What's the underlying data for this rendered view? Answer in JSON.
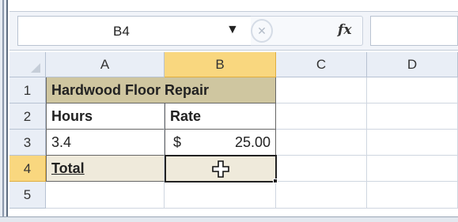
{
  "formula_bar": {
    "name_box": "B4",
    "name_box_arrow": "▼",
    "cancel_symbol": "✕",
    "fx_label": "fx",
    "formula_value": ""
  },
  "columns": [
    "A",
    "B",
    "C",
    "D"
  ],
  "rows": [
    "1",
    "2",
    "3",
    "4",
    "5"
  ],
  "cells": {
    "a1": "Hardwood Floor Repair",
    "a2": "Hours",
    "b2": "Rate",
    "a3": "3.4",
    "b3_currency": "$",
    "b3_value": "25.00",
    "a4": "Total"
  },
  "selection": {
    "active_cell": "B4"
  },
  "colors": {
    "header_selected": "#f9d77f",
    "title_fill": "#cfc6a0",
    "total_fill": "#efeadb"
  },
  "icons": {
    "cursor": "plus-cursor-icon",
    "cancel": "cancel-icon",
    "fx": "insert-function-icon"
  }
}
